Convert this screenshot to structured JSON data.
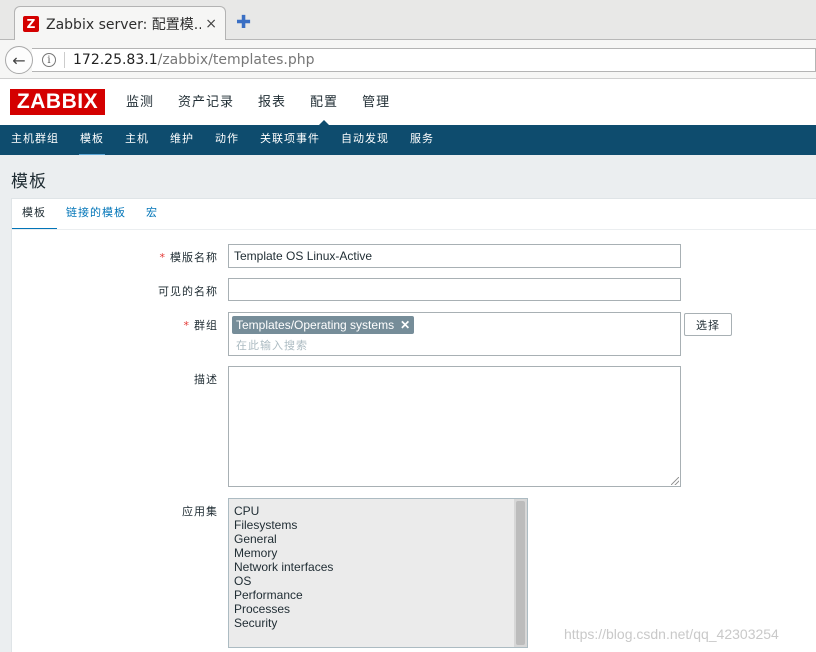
{
  "browser": {
    "tab_title": "Zabbix server: 配置模...",
    "favicon_letter": "Z",
    "tab_close": "×",
    "new_tab": "✚",
    "back": "←",
    "info": "i",
    "url_host": "172.25.83.1",
    "url_path": "/zabbix/templates.php"
  },
  "header": {
    "logo": "ZABBIX",
    "menu": [
      {
        "label": "监测"
      },
      {
        "label": "资产记录"
      },
      {
        "label": "报表"
      },
      {
        "label": "配置"
      },
      {
        "label": "管理"
      }
    ],
    "active_menu": "配置"
  },
  "submenu": {
    "items": [
      {
        "label": "主机群组"
      },
      {
        "label": "模板"
      },
      {
        "label": "主机"
      },
      {
        "label": "维护"
      },
      {
        "label": "动作"
      },
      {
        "label": "关联项事件"
      },
      {
        "label": "自动发现"
      },
      {
        "label": "服务"
      }
    ],
    "active": "模板"
  },
  "page": {
    "title": "模板"
  },
  "form_tabs": [
    {
      "label": "模板"
    },
    {
      "label": "链接的模板"
    },
    {
      "label": "宏"
    }
  ],
  "form": {
    "required_mark": "*",
    "template_name_label": "模版名称",
    "template_name_value": "Template OS Linux-Active",
    "visible_name_label": "可见的名称",
    "visible_name_value": "",
    "groups_label": "群组",
    "group_chip": "Templates/Operating systems",
    "group_chip_remove": "✕",
    "groups_placeholder": "在此输入搜索",
    "select_button": "选择",
    "description_label": "描述",
    "description_value": "",
    "applications_label": "应用集",
    "applications": [
      "CPU",
      "Filesystems",
      "General",
      "Memory",
      "Network interfaces",
      "OS",
      "Performance",
      "Processes",
      "Security"
    ]
  },
  "watermark": "https://blog.csdn.net/qq_42303254"
}
